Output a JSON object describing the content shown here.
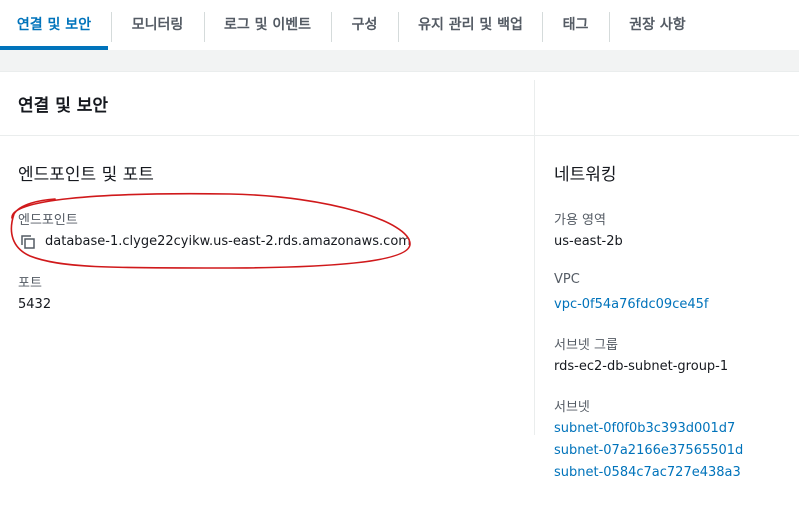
{
  "tabs": [
    {
      "label": "연결 및 보안",
      "active": true
    },
    {
      "label": "모니터링",
      "active": false
    },
    {
      "label": "로그 및 이벤트",
      "active": false
    },
    {
      "label": "구성",
      "active": false
    },
    {
      "label": "유지 관리 및 백업",
      "active": false
    },
    {
      "label": "태그",
      "active": false
    },
    {
      "label": "권장 사항",
      "active": false
    }
  ],
  "panel": {
    "title": "연결 및 보안"
  },
  "endpoint_section": {
    "title": "엔드포인트 및 포트",
    "endpoint_label": "엔드포인트",
    "endpoint_value": "database-1.clyge22cyikw.us-east-2.rds.amazonaws.com",
    "port_label": "포트",
    "port_value": "5432"
  },
  "network_section": {
    "title": "네트워킹",
    "az_label": "가용 영역",
    "az_value": "us-east-2b",
    "vpc_label": "VPC",
    "vpc_value": "vpc-0f54a76fdc09ce45f",
    "subnet_group_label": "서브넷 그룹",
    "subnet_group_value": "rds-ec2-db-subnet-group-1",
    "subnets_label": "서브넷",
    "subnets": [
      "subnet-0f0f0b3c393d001d7",
      "subnet-07a2166e37565501d",
      "subnet-0584c7ac727e438a3"
    ]
  },
  "colors": {
    "accent": "#0073bb",
    "annotation": "#d0191b"
  },
  "icons": {
    "copy": "copy-icon"
  }
}
